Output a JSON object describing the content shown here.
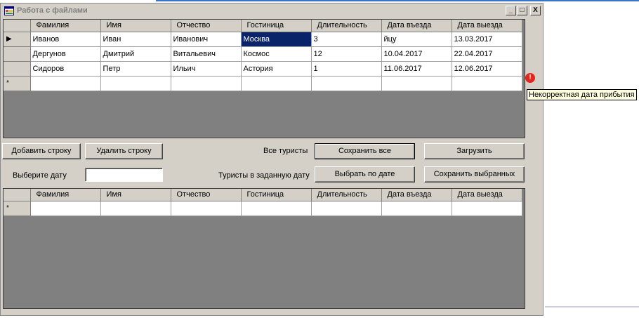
{
  "window": {
    "title": "Работа с файлами",
    "buttons": {
      "minimize": "_",
      "maximize": "□",
      "close": "X"
    }
  },
  "grid_top": {
    "columns": [
      "Фамилия",
      "Имя",
      "Отчество",
      "Гостиница",
      "Длительность",
      "Дата въезда",
      "Дата выезда"
    ],
    "rows": [
      {
        "marker": "▶",
        "cells": [
          "Иванов",
          "Иван",
          "Иванович",
          "Москва",
          "3",
          "йцу",
          "13.03.2017"
        ]
      },
      {
        "marker": "",
        "cells": [
          "Дергунов",
          "Дмитрий",
          "Витальевич",
          "Космос",
          "12",
          "10.04.2017",
          "22.04.2017"
        ]
      },
      {
        "marker": "",
        "cells": [
          "Сидоров",
          "Петр",
          "Ильич",
          "Астория",
          "1",
          "11.06.2017",
          "12.06.2017"
        ]
      },
      {
        "marker": "*",
        "cells": [
          "",
          "",
          "",
          "",
          "",
          "",
          ""
        ]
      }
    ]
  },
  "controls": {
    "add_row": "Добавить строку",
    "delete_row": "Удалить строку",
    "all_tourists_label": "Все туристы",
    "save_all": "Сохранить все",
    "load": "Загрузить",
    "choose_date_label": "Выберите дату",
    "date_value": "",
    "tourists_on_date_label": "Туристы в заданную дату",
    "select_by_date": "Выбрать по дате",
    "save_selected": "Сохранить выбранных"
  },
  "grid_bottom": {
    "columns": [
      "Фамилия",
      "Имя",
      "Отчество",
      "Гостиница",
      "Длительность",
      "Дата въезда",
      "Дата выезда"
    ],
    "rows": [
      {
        "marker": "*",
        "cells": [
          "",
          "",
          "",
          "",
          "",
          "",
          ""
        ]
      }
    ]
  },
  "error": {
    "icon": "!",
    "tooltip": "Некорректная дата прибытия"
  },
  "colors": {
    "selection": "#0a246a",
    "grid_background": "#808080",
    "error": "#e3261b"
  }
}
